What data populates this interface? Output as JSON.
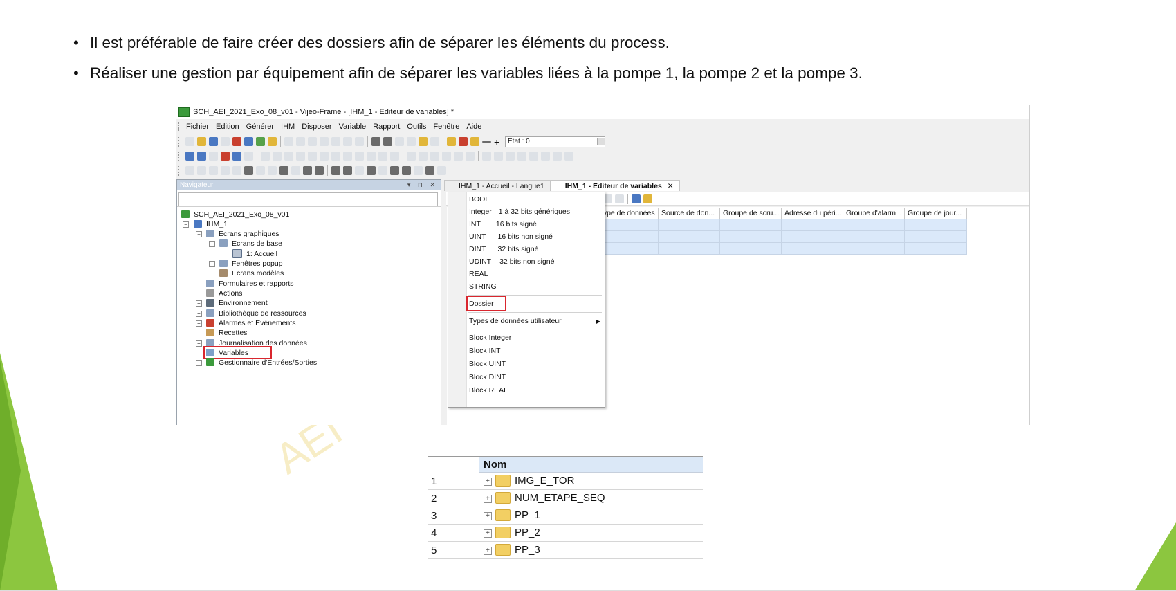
{
  "slide": {
    "bullets": [
      "Il est préférable de faire créer des dossiers afin de séparer les éléments du process.",
      "Réaliser une gestion par équipement afin de séparer les variables liées à la pompe 1, la pompe 2 et la pompe 3."
    ],
    "watermark": "AEI",
    "accent_color": "#8cc63f"
  },
  "app": {
    "title": "SCH_AEI_2021_Exo_08_v01 - Vijeo-Frame - [IHM_1 - Editeur de variables] *",
    "menu": [
      "Fichier",
      "Edition",
      "Générer",
      "IHM",
      "Disposer",
      "Variable",
      "Rapport",
      "Outils",
      "Fenêtre",
      "Aide"
    ],
    "state_label": "Etat : 0",
    "navigator": {
      "title": "Navigateur",
      "tree": [
        {
          "label": "SCH_AEI_2021_Exo_08_v01",
          "icon": "project-icon"
        },
        {
          "label": "IHM_1",
          "icon": "hmi-icon"
        },
        {
          "label": "Ecrans graphiques",
          "icon": "screens-icon"
        },
        {
          "label": "Ecrans de base",
          "icon": "screens-icon"
        },
        {
          "label": "1: Accueil",
          "icon": "screen-icon"
        },
        {
          "label": "Fenêtres popup",
          "icon": "popup-icon"
        },
        {
          "label": "Ecrans modèles",
          "icon": "template-icon"
        },
        {
          "label": "Formulaires et rapports",
          "icon": "report-icon"
        },
        {
          "label": "Actions",
          "icon": "actions-icon"
        },
        {
          "label": "Environnement",
          "icon": "environment-icon"
        },
        {
          "label": "Bibliothèque de ressources",
          "icon": "library-icon"
        },
        {
          "label": "Alarmes et Evénements",
          "icon": "alarm-icon"
        },
        {
          "label": "Recettes",
          "icon": "recipe-icon"
        },
        {
          "label": "Journalisation des données",
          "icon": "logging-icon"
        },
        {
          "label": "Variables",
          "icon": "variables-icon"
        },
        {
          "label": "Gestionnaire d'Entrées/Sorties",
          "icon": "io-manager-icon"
        }
      ]
    },
    "tabs": [
      {
        "label": "IHM_1 - Accueil - Langue1",
        "active": false
      },
      {
        "label": "IHM_1 - Editeur de variables",
        "active": true
      }
    ],
    "grid_columns": [
      "Type de données",
      "Source de don...",
      "Groupe de scru...",
      "Adresse du péri...",
      "Groupe d'alarm...",
      "Groupe de jour..."
    ],
    "type_menu": {
      "items": [
        {
          "label": "BOOL",
          "desc": ""
        },
        {
          "label": "Integer",
          "desc": "1 à 32 bits génériques"
        },
        {
          "label": "INT",
          "desc": "16 bits signé"
        },
        {
          "label": "UINT",
          "desc": "16 bits non signé"
        },
        {
          "label": "DINT",
          "desc": "32 bits signé"
        },
        {
          "label": "UDINT",
          "desc": "32 bits non signé"
        },
        {
          "label": "REAL",
          "desc": ""
        },
        {
          "label": "STRING",
          "desc": ""
        }
      ],
      "folder": "Dossier",
      "user_types": "Types de données utilisateur",
      "blocks": [
        "Block Integer",
        "Block INT",
        "Block UINT",
        "Block DINT",
        "Block REAL"
      ]
    }
  },
  "variables_table": {
    "header": "Nom",
    "rows": [
      {
        "num": "1",
        "name": "IMG_E_TOR"
      },
      {
        "num": "2",
        "name": "NUM_ETAPE_SEQ"
      },
      {
        "num": "3",
        "name": "PP_1"
      },
      {
        "num": "4",
        "name": "PP_2"
      },
      {
        "num": "5",
        "name": "PP_3"
      }
    ]
  }
}
